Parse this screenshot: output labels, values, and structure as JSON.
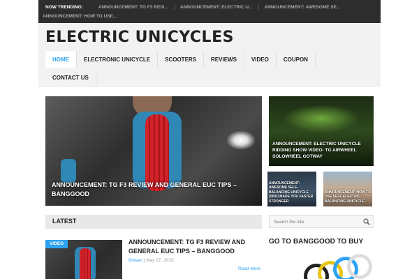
{
  "trending": {
    "label": "NOW TRENDING:",
    "items": [
      "ANNOUNCEMENT: TG F3 REVI...",
      "ANNOUNCEMENT: ELECTRIC U...",
      "ANNOUNCEMENT: AWESOME SE...",
      "ANNOUNCEMENT: HOW TO USE..."
    ]
  },
  "site": {
    "title": "ELECTRIC UNICYCLES"
  },
  "nav": {
    "items": [
      "HOME",
      "ELECTRONIC UNICYCLE",
      "SCOOTERS",
      "REVIEWS",
      "VIDEO",
      "COUPON",
      "CONTACT US"
    ],
    "active": "HOME"
  },
  "featured": {
    "main_caption": "ANNOUNCEMENT: TG F3 REVIEW AND GENERAL EUC TIPS – BANGGOOD",
    "side_big_caption": "ANNOUNCEMENT: ELECTRIC UNICYCLE RIDDING SHOW VIDEO- TG AIRWHEEL SOLOWHEEL GOTWAY",
    "side_small1_caption": "ANNOUNCEMENT: AWESOME SELF-BALANCING UNICYCLE (SBU) MADE YOU FASTER STRONGER",
    "side_small2_caption": "ANNOUNCEMENT: HOW TO USE SELF ELECTRIC BALANCING UNICYCLE"
  },
  "latest": {
    "heading": "LATEST"
  },
  "search": {
    "placeholder": "Search the site"
  },
  "post": {
    "badge": "VIDEO",
    "title": "ANNOUNCEMENT: TG F3 REVIEW AND GENERAL EUC TIPS – BANGGOOD",
    "author": "Bowen",
    "separator": "|",
    "date": "May 27, 2015",
    "read_more": "Read More"
  },
  "sidebar": {
    "heading": "GO TO BANGGOOD TO BUY"
  },
  "colors": {
    "accent": "#2ea3f2",
    "topbar": "#2d2d2d",
    "header_bg": "#f2f2f2"
  }
}
